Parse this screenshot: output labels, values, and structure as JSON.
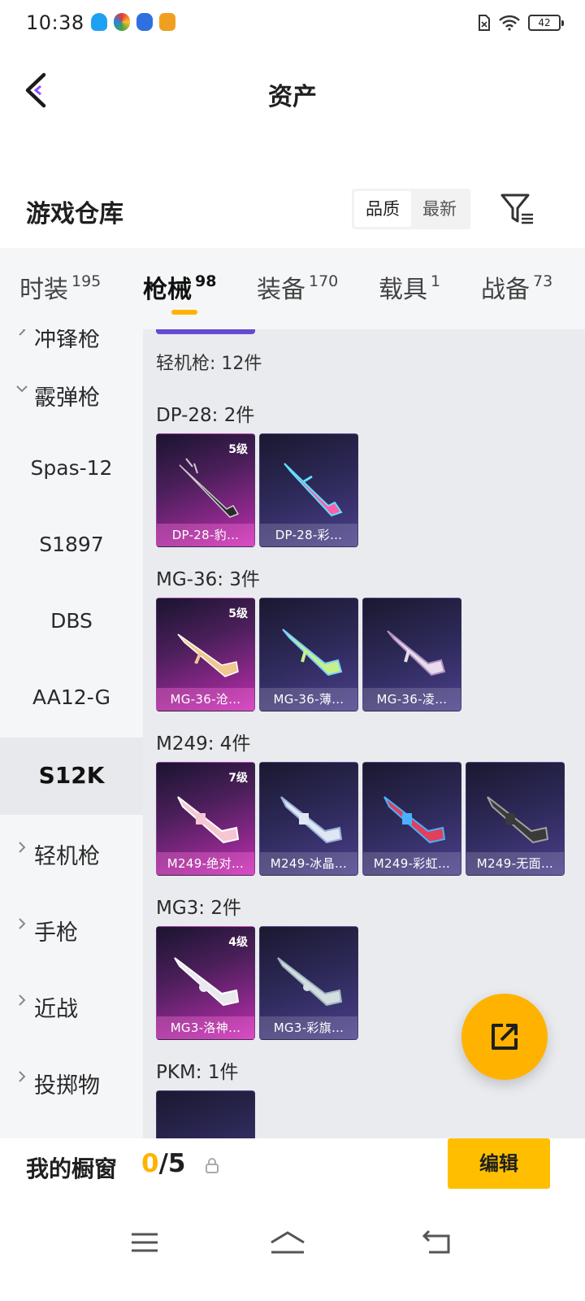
{
  "status_bar": {
    "time": "10:38",
    "battery": "42"
  },
  "nav": {
    "title": "资产"
  },
  "warehouse": {
    "title": "游戏仓库",
    "sort_options": [
      "品质",
      "最新"
    ],
    "active_sort": "品质"
  },
  "tabs": [
    {
      "label": "时装",
      "count": "195"
    },
    {
      "label": "枪械",
      "count": "98"
    },
    {
      "label": "装备",
      "count": "170"
    },
    {
      "label": "载具",
      "count": "1"
    },
    {
      "label": "战备",
      "count": "73"
    }
  ],
  "active_tab": "枪械",
  "sidebar": {
    "items": [
      {
        "label": "冲锋枪",
        "type": "group"
      },
      {
        "label": "霰弹枪",
        "type": "group",
        "expanded": true
      },
      {
        "label": "Spas-12",
        "type": "sub"
      },
      {
        "label": "S1897",
        "type": "sub"
      },
      {
        "label": "DBS",
        "type": "sub"
      },
      {
        "label": "AA12-G",
        "type": "sub"
      },
      {
        "label": "S12K",
        "type": "sub",
        "selected": true
      },
      {
        "label": "轻机枪",
        "type": "group"
      },
      {
        "label": "手枪",
        "type": "group"
      },
      {
        "label": "近战",
        "type": "group"
      },
      {
        "label": "投掷物",
        "type": "group"
      }
    ]
  },
  "content": {
    "section_title": "轻机枪: 12件",
    "groups": [
      {
        "title": "DP-28: 2件",
        "cards": [
          {
            "name": "DP-28-豹…",
            "level": "5级",
            "style": "pink"
          },
          {
            "name": "DP-28-彩…",
            "level": "",
            "style": "purple"
          }
        ]
      },
      {
        "title": "MG-36: 3件",
        "cards": [
          {
            "name": "MG-36-沧…",
            "level": "5级",
            "style": "pink"
          },
          {
            "name": "MG-36-薄…",
            "level": "",
            "style": "purple"
          },
          {
            "name": "MG-36-凌…",
            "level": "",
            "style": "purple"
          }
        ]
      },
      {
        "title": "M249: 4件",
        "cards": [
          {
            "name": "M249-绝对…",
            "level": "7级",
            "style": "pink"
          },
          {
            "name": "M249-冰晶…",
            "level": "",
            "style": "purple"
          },
          {
            "name": "M249-彩虹…",
            "level": "",
            "style": "purple"
          },
          {
            "name": "M249-无面…",
            "level": "",
            "style": "purple"
          }
        ]
      },
      {
        "title": "MG3: 2件",
        "cards": [
          {
            "name": "MG3-洛神…",
            "level": "4级",
            "style": "pink"
          },
          {
            "name": "MG3-彩旗…",
            "level": "",
            "style": "purple"
          }
        ]
      },
      {
        "title": "PKM: 1件",
        "cards": []
      }
    ]
  },
  "showcase": {
    "label": "我的橱窗",
    "current": "0",
    "total": "/5",
    "edit_label": "编辑"
  },
  "colors": {
    "accent": "#ffb300",
    "pink_card": "#c634b8",
    "purple_card": "#4a3f8c"
  }
}
